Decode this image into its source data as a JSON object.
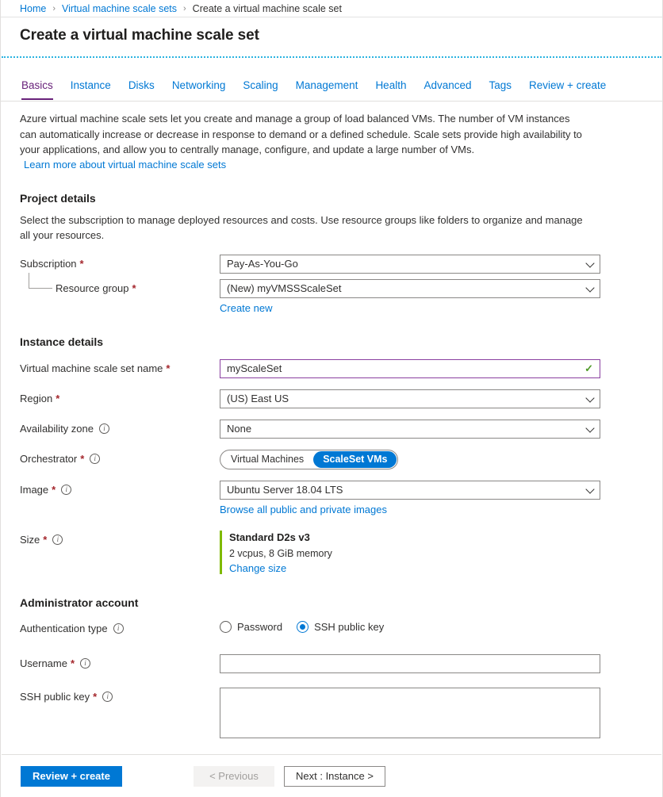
{
  "breadcrumb": {
    "items": [
      {
        "label": "Home",
        "link": true
      },
      {
        "label": "Virtual machine scale sets",
        "link": true
      },
      {
        "label": "Create a virtual machine scale set",
        "link": false
      }
    ],
    "separator": "›"
  },
  "header": {
    "title": "Create a virtual machine scale set"
  },
  "tabs": [
    {
      "label": "Basics",
      "active": true
    },
    {
      "label": "Instance",
      "active": false
    },
    {
      "label": "Disks",
      "active": false
    },
    {
      "label": "Networking",
      "active": false
    },
    {
      "label": "Scaling",
      "active": false
    },
    {
      "label": "Management",
      "active": false
    },
    {
      "label": "Health",
      "active": false
    },
    {
      "label": "Advanced",
      "active": false
    },
    {
      "label": "Tags",
      "active": false
    },
    {
      "label": "Review + create",
      "active": false
    }
  ],
  "intro": {
    "paragraph": "Azure virtual machine scale sets let you create and manage a group of load balanced VMs. The number of VM instances can automatically increase or decrease in response to demand or a defined schedule. Scale sets provide high availability to your applications, and allow you to centrally manage, configure, and update a large number of VMs.",
    "learn_more": "Learn more about virtual machine scale sets"
  },
  "project_details": {
    "title": "Project details",
    "description": "Select the subscription to manage deployed resources and costs. Use resource groups like folders to organize and manage all your resources.",
    "subscription": {
      "label": "Subscription",
      "required": "*",
      "value": "Pay-As-You-Go"
    },
    "resource_group": {
      "label": "Resource group",
      "required": "*",
      "value": "(New) myVMSSScaleSet",
      "create_new": "Create new"
    }
  },
  "instance_details": {
    "title": "Instance details",
    "name": {
      "label": "Virtual machine scale set name",
      "required": "*",
      "value": "myScaleSet",
      "placeholder": "",
      "validation": "valid"
    },
    "region": {
      "label": "Region",
      "required": "*",
      "value": "(US) East US"
    },
    "availability_zone": {
      "label": "Availability zone",
      "value": "None"
    },
    "orchestrator": {
      "label": "Orchestrator",
      "required": "*",
      "options": [
        {
          "label": "Virtual Machines",
          "selected": false
        },
        {
          "label": "ScaleSet VMs",
          "selected": true
        }
      ],
      "selected_color": "#0078d4"
    },
    "image": {
      "label": "Image",
      "required": "*",
      "value": "Ubuntu Server 18.04 LTS",
      "browse_link": "Browse all public and private images"
    },
    "size": {
      "label": "Size",
      "required": "*",
      "name": "Standard D2s v3",
      "specs": "2 vcpus, 8 GiB memory",
      "change_link": "Change size",
      "accent_color": "#7fba00"
    }
  },
  "administrator_account": {
    "title": "Administrator account",
    "authentication_type": {
      "label": "Authentication type",
      "options": [
        {
          "label": "Password",
          "selected": false
        },
        {
          "label": "SSH public key",
          "selected": true
        }
      ]
    },
    "username": {
      "label": "Username",
      "required": "*",
      "value": "",
      "placeholder": ""
    },
    "ssh_public_key": {
      "label": "SSH public key",
      "required": "*",
      "value": "",
      "placeholder": ""
    }
  },
  "footer": {
    "review_create": "Review + create",
    "previous": "< Previous",
    "next": "Next : Instance >"
  },
  "icons": {
    "info": "ⓘ",
    "check": "✓",
    "chevron_down": "chevron-down"
  }
}
